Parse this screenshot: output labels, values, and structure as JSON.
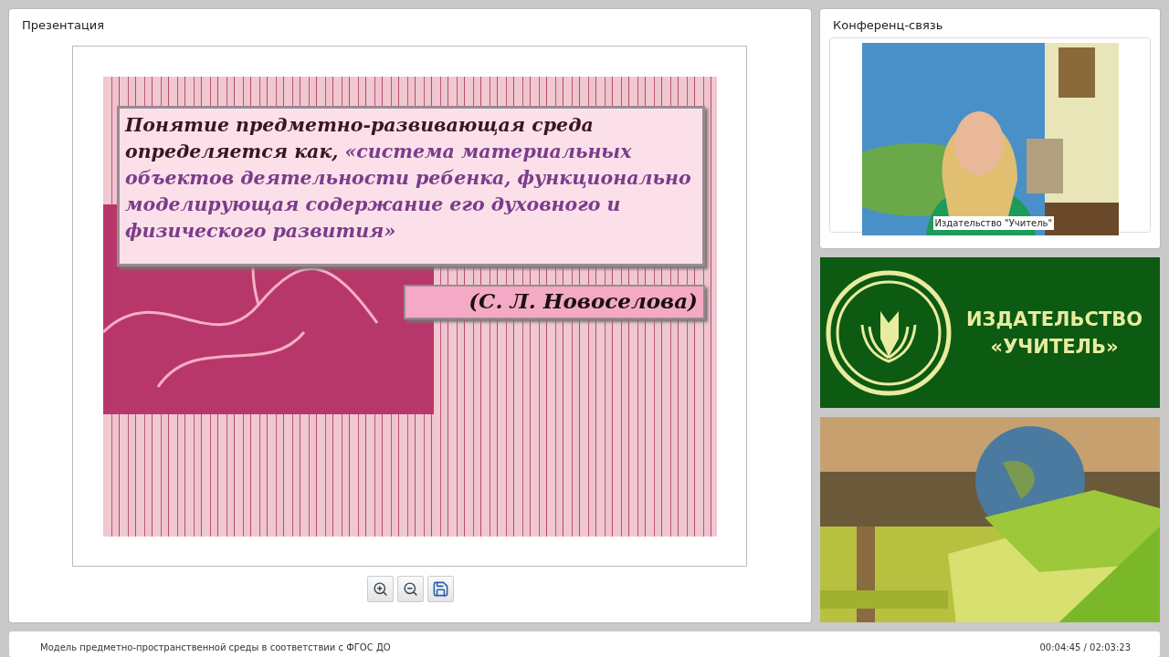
{
  "presentation": {
    "title": "Презентация",
    "slide": {
      "text_lead": "Понятие предметно-развивающая среда определяется как, ",
      "text_quote": "«система материальных объектов деятельности ребенка, функционально моделирующая содержание его духовного и физического развития»",
      "author": "(С. Л. Новоселова)"
    },
    "tools": [
      {
        "kind": "zoom-in"
      },
      {
        "kind": "zoom-out"
      },
      {
        "kind": "save"
      }
    ]
  },
  "conference": {
    "title": "Конференц-связь",
    "caption": "Издательство \"Учитель\""
  },
  "banner": {
    "lines": [
      "ИЗДАТЕЛЬСТВО",
      "«УЧИТЕЛЬ»"
    ]
  },
  "status_bar": {
    "title": "Модель предметно-пространственной среды в соответствии с ФГОС ДО",
    "time": "00:04:45 / 02:03:23"
  }
}
